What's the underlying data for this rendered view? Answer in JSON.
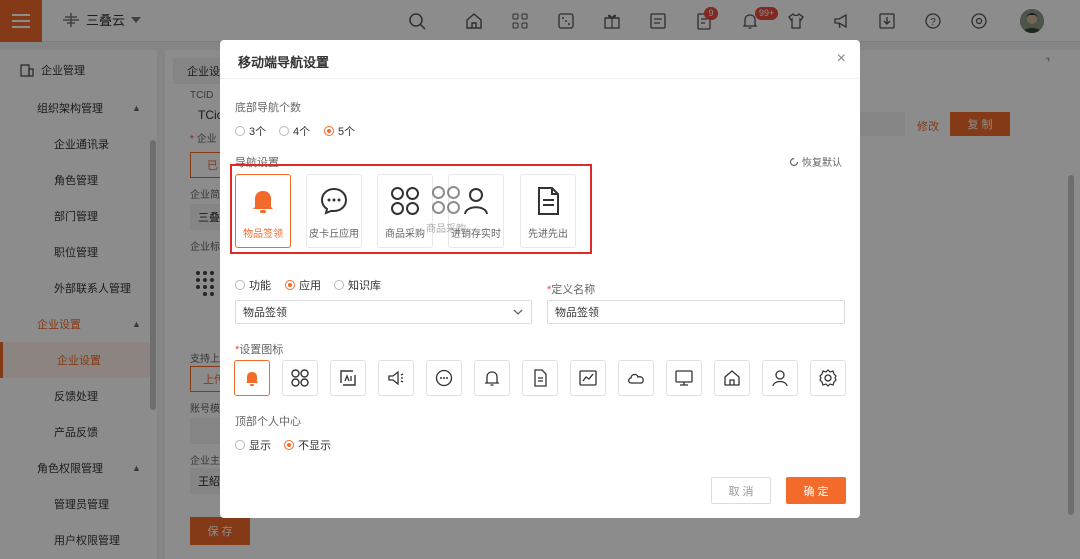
{
  "topbar": {
    "company": "三叠云",
    "msg_badge": "9",
    "notify_badge": "99+"
  },
  "sidebar": {
    "items": [
      {
        "label": "企业管理",
        "level": 0
      },
      {
        "label": "组织架构管理",
        "level": 1
      },
      {
        "label": "企业通讯录",
        "level": 2
      },
      {
        "label": "角色管理",
        "level": 2
      },
      {
        "label": "部门管理",
        "level": 2
      },
      {
        "label": "职位管理",
        "level": 2
      },
      {
        "label": "外部联系人管理",
        "level": 2
      },
      {
        "label": "企业设置",
        "level": 1
      },
      {
        "label": "企业设置",
        "level": 2
      },
      {
        "label": "反馈处理",
        "level": 2
      },
      {
        "label": "产品反馈",
        "level": 2
      },
      {
        "label": "角色权限管理",
        "level": 1
      },
      {
        "label": "管理员管理",
        "level": 2
      },
      {
        "label": "用户权限管理",
        "level": 2
      }
    ]
  },
  "main": {
    "tab": "企业设",
    "tcid_label": "TCID",
    "tcid_value": "TCio",
    "company_label": "企业",
    "already_btn": "已",
    "company_abbr_label": "企业简",
    "company_abbr_value": "三叠",
    "company_logo_label": "企业标",
    "support_label": "支持上",
    "upload_btn": "上传",
    "account_label": "账号模",
    "owner_label": "企业主",
    "owner_value": "王紹",
    "edit_link": "修改",
    "copy_btn": "复 制",
    "save_btn": "保 存"
  },
  "modal": {
    "title": "移动端导航设置",
    "close": "×",
    "bottom_nav_count_label": "底部导航个数",
    "count_options": [
      {
        "label": "3个",
        "selected": false
      },
      {
        "label": "4个",
        "selected": false
      },
      {
        "label": "5个",
        "selected": true
      }
    ],
    "nav_settings_label": "导航设置",
    "restore_default": "恢复默认",
    "nav_cards": [
      {
        "label": "物品签领",
        "icon": "bell-icon",
        "active": true
      },
      {
        "label": "皮卡丘应用",
        "icon": "chat-icon",
        "active": false
      },
      {
        "label": "商品采购",
        "icon": "apps-icon",
        "active": false
      },
      {
        "label": "进销存实时",
        "icon": "user-icon",
        "active": false
      },
      {
        "label": "先进先出",
        "icon": "document-icon",
        "active": false
      }
    ],
    "drag_ghost_label": "商品采购",
    "type_options": [
      {
        "label": "功能",
        "selected": false
      },
      {
        "label": "应用",
        "selected": true
      },
      {
        "label": "知识库",
        "selected": false
      }
    ],
    "custom_name_label": "定义名称",
    "app_select_value": "物品签领",
    "custom_name_value": "物品签领",
    "set_icon_label": "设置图标",
    "icons": [
      "bell-icon",
      "apps-icon",
      "chart-ai-icon",
      "megaphone-icon",
      "chat-icon",
      "bell-outline-icon",
      "document-icon",
      "line-chart-icon",
      "cloud-icon",
      "monitor-icon",
      "home-icon",
      "user-icon",
      "gear-icon"
    ],
    "top_personal_label": "顶部个人中心",
    "personal_options": [
      {
        "label": "显示",
        "selected": false
      },
      {
        "label": "不显示",
        "selected": true
      }
    ],
    "cancel_btn": "取 消",
    "confirm_btn": "确 定"
  },
  "colors": {
    "accent": "#f26b2a",
    "highlight_box": "#e02a2a"
  }
}
